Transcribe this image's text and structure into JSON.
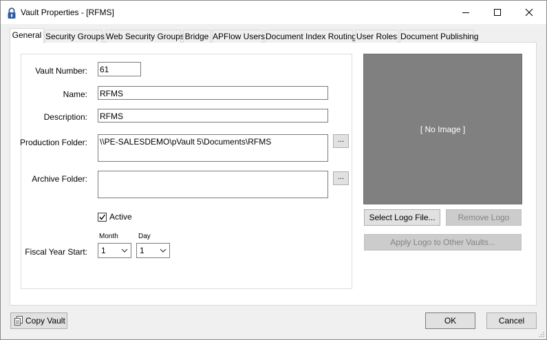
{
  "window": {
    "title": "Vault Properties - [RFMS]",
    "icon": "lock-icon",
    "controls": {
      "minimize": "minimize-icon",
      "maximize": "maximize-icon",
      "close": "close-icon"
    }
  },
  "tabs": [
    {
      "label": "General",
      "active": true
    },
    {
      "label": "Security Groups",
      "active": false
    },
    {
      "label": "Web Security Groups",
      "active": false
    },
    {
      "label": "Bridge",
      "active": false
    },
    {
      "label": "APFlow Users",
      "active": false
    },
    {
      "label": "Document Index Routing",
      "active": false
    },
    {
      "label": "User Roles",
      "active": false
    },
    {
      "label": "Document Publishing",
      "active": false
    }
  ],
  "general": {
    "vault_number": {
      "label": "Vault Number:",
      "value": "61"
    },
    "name": {
      "label": "Name:",
      "value": "RFMS"
    },
    "description": {
      "label": "Description:",
      "value": "RFMS"
    },
    "production_folder": {
      "label": "Production Folder:",
      "value": "\\\\PE-SALESDEMO\\pVault 5\\Documents\\RFMS",
      "browse_label": "..."
    },
    "archive_folder": {
      "label": "Archive Folder:",
      "value": "",
      "browse_label": "..."
    },
    "active": {
      "label": "Active",
      "checked": true
    },
    "fiscal_year_start": {
      "label": "Fiscal Year Start:",
      "month_label": "Month",
      "month_value": "1",
      "day_label": "Day",
      "day_value": "1"
    }
  },
  "logo": {
    "placeholder": "[ No Image ]",
    "select_button": "Select Logo File...",
    "remove_button": "Remove Logo",
    "apply_button": "Apply Logo to Other Vaults..."
  },
  "footer": {
    "copy_vault": "Copy Vault",
    "copy_icon": "copy-icon",
    "ok": "OK",
    "cancel": "Cancel"
  },
  "colors": {
    "logo_background": "#808080",
    "window_background": "#f0f0f0",
    "button_face": "#e1e1e1",
    "disabled_button": "#cccccc"
  }
}
